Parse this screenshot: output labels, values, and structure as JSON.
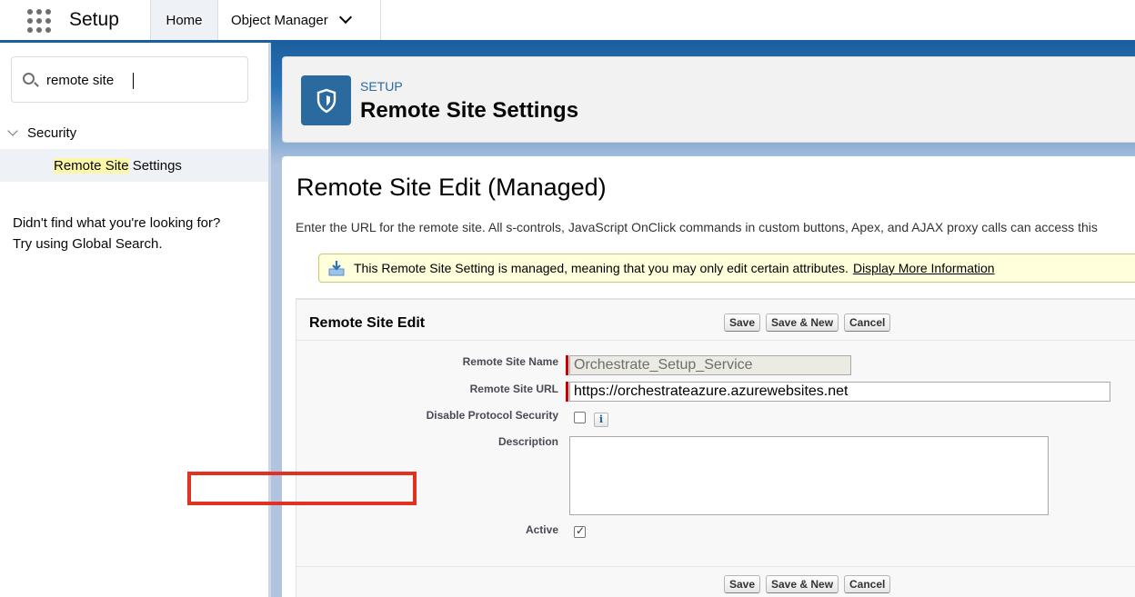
{
  "header": {
    "app_name": "Setup",
    "tabs": [
      {
        "label": "Home"
      },
      {
        "label": "Object Manager"
      }
    ]
  },
  "sidebar": {
    "search": {
      "value": "remote site"
    },
    "tree": {
      "parent_label": "Security",
      "child_highlight": "Remote Site",
      "child_rest": " Settings"
    },
    "help_line1": "Didn't find what you're looking for?",
    "help_line2": "Try using Global Search."
  },
  "page_header": {
    "eyebrow": "SETUP",
    "title": "Remote Site Settings"
  },
  "content": {
    "title": "Remote Site Edit (Managed)",
    "description": "Enter the URL for the remote site. All s-controls, JavaScript OnClick commands in custom buttons, Apex, and AJAX proxy calls can access this",
    "info_text": "This Remote Site Setting is managed, meaning that you may only edit certain attributes.",
    "info_link": "Display More Information"
  },
  "form": {
    "section_title": "Remote Site Edit",
    "buttons": {
      "save": "Save",
      "save_new": "Save & New",
      "cancel": "Cancel"
    },
    "fields": {
      "name_label": "Remote Site Name",
      "name_value": "Orchestrate_Setup_Service",
      "url_label": "Remote Site URL",
      "url_value": "https://orchestrateazure.azurewebsites.net",
      "disable_label": "Disable Protocol Security",
      "disable_checked": false,
      "description_label": "Description",
      "description_value": "",
      "active_label": "Active",
      "active_checked": true
    }
  },
  "colors": {
    "brand": "#1b5f9e",
    "highlight_box": "#e03121",
    "required": "#cc0000"
  }
}
